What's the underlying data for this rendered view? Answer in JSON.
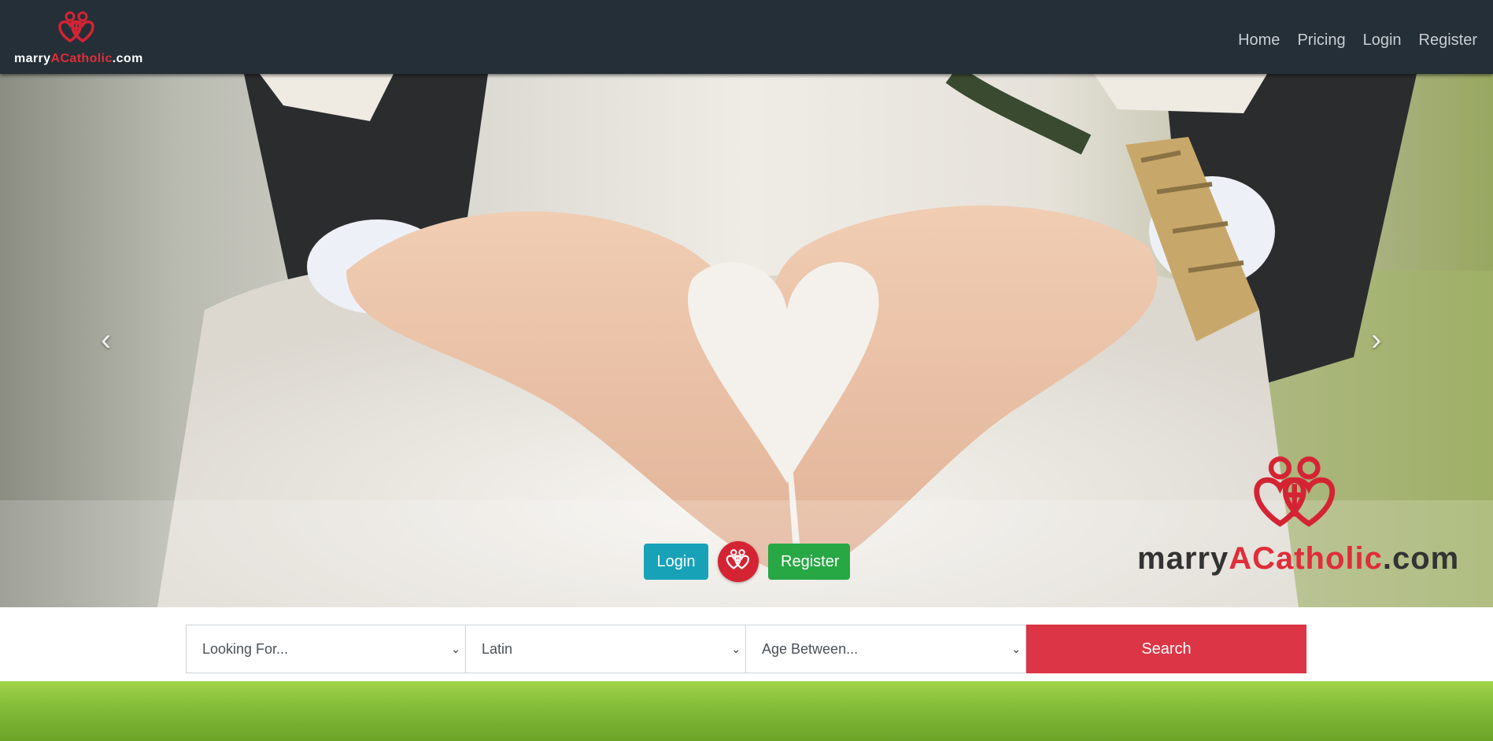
{
  "brand": {
    "text_prefix": "marry",
    "text_accent": "ACatholic",
    "text_suffix": ".com",
    "accent_color": "#e02d3a",
    "icon": "hearts-cross-logo"
  },
  "nav": {
    "items": [
      "Home",
      "Pricing",
      "Login",
      "Register"
    ]
  },
  "hero": {
    "prev_icon": "chevron-left-icon",
    "next_icon": "chevron-right-icon",
    "login_label": "Login",
    "register_label": "Register"
  },
  "search": {
    "looking_for": "Looking For...",
    "ethnicity": "Latin",
    "age": "Age Between...",
    "button_label": "Search"
  },
  "colors": {
    "navbar": "#252f37",
    "login": "#17a2b8",
    "register": "#28a745",
    "search": "#dc3545"
  }
}
